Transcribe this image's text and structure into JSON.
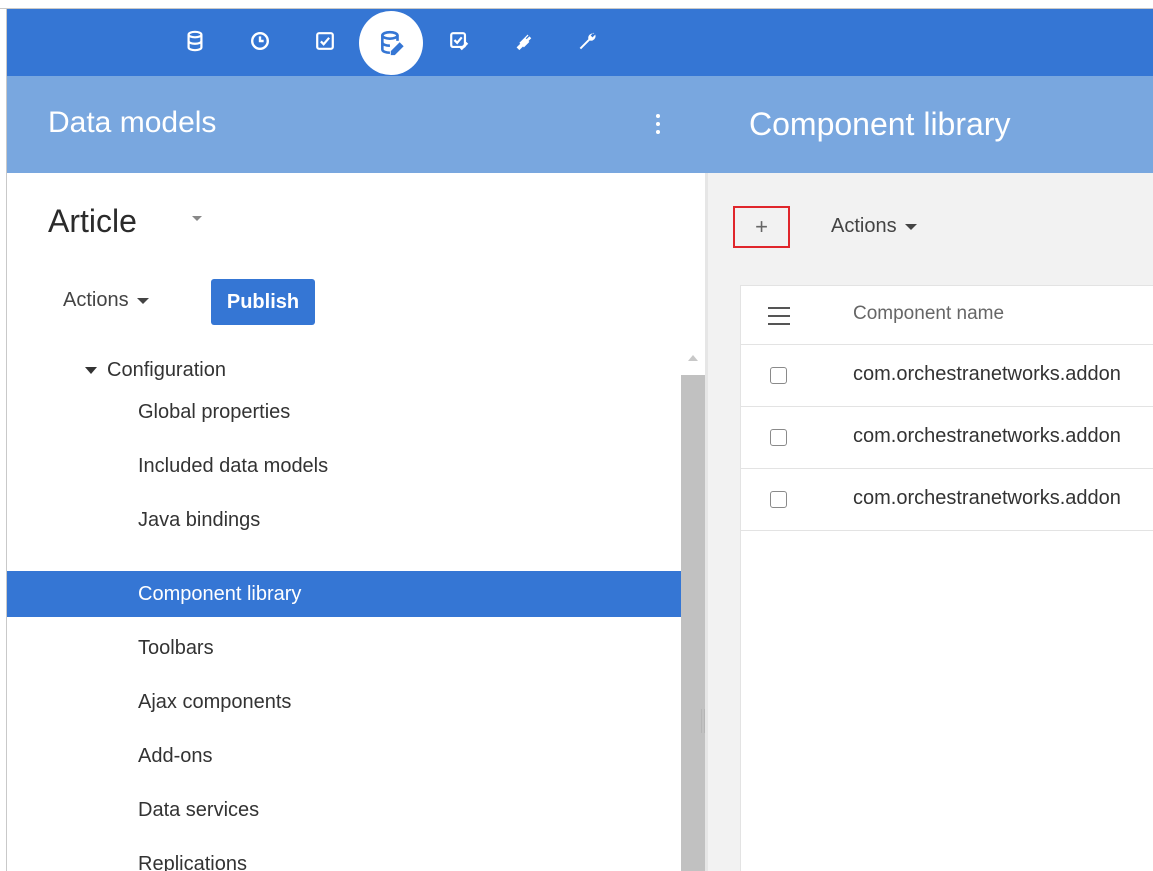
{
  "topbar": {
    "icons": [
      {
        "name": "database-icon"
      },
      {
        "name": "clock-icon"
      },
      {
        "name": "checkbox-icon"
      },
      {
        "name": "data-model-icon",
        "active": true
      },
      {
        "name": "checklist-edit-icon"
      },
      {
        "name": "plug-icon"
      },
      {
        "name": "wrench-icon"
      }
    ]
  },
  "header": {
    "left_title": "Data models",
    "right_title": "Component library"
  },
  "left_panel": {
    "record_title": "Article",
    "actions_label": "Actions",
    "publish_label": "Publish",
    "tree": {
      "parent_label": "Configuration",
      "items": [
        {
          "label": "Global properties"
        },
        {
          "label": "Included data models"
        },
        {
          "label": "Java bindings"
        },
        {
          "label": "Component library",
          "selected": true
        },
        {
          "label": "Toolbars"
        },
        {
          "label": "Ajax components"
        },
        {
          "label": "Add-ons"
        },
        {
          "label": "Data services"
        },
        {
          "label": "Replications"
        }
      ]
    }
  },
  "right_panel": {
    "add_label": "+",
    "actions_label": "Actions",
    "table": {
      "column_header": "Component name",
      "rows": [
        {
          "name": "com.orchestranetworks.addon"
        },
        {
          "name": "com.orchestranetworks.addon"
        },
        {
          "name": "com.orchestranetworks.addon"
        }
      ]
    }
  },
  "colors": {
    "primary": "#3576d4",
    "header_band": "#79a7df",
    "highlight_border": "#e0262b"
  }
}
